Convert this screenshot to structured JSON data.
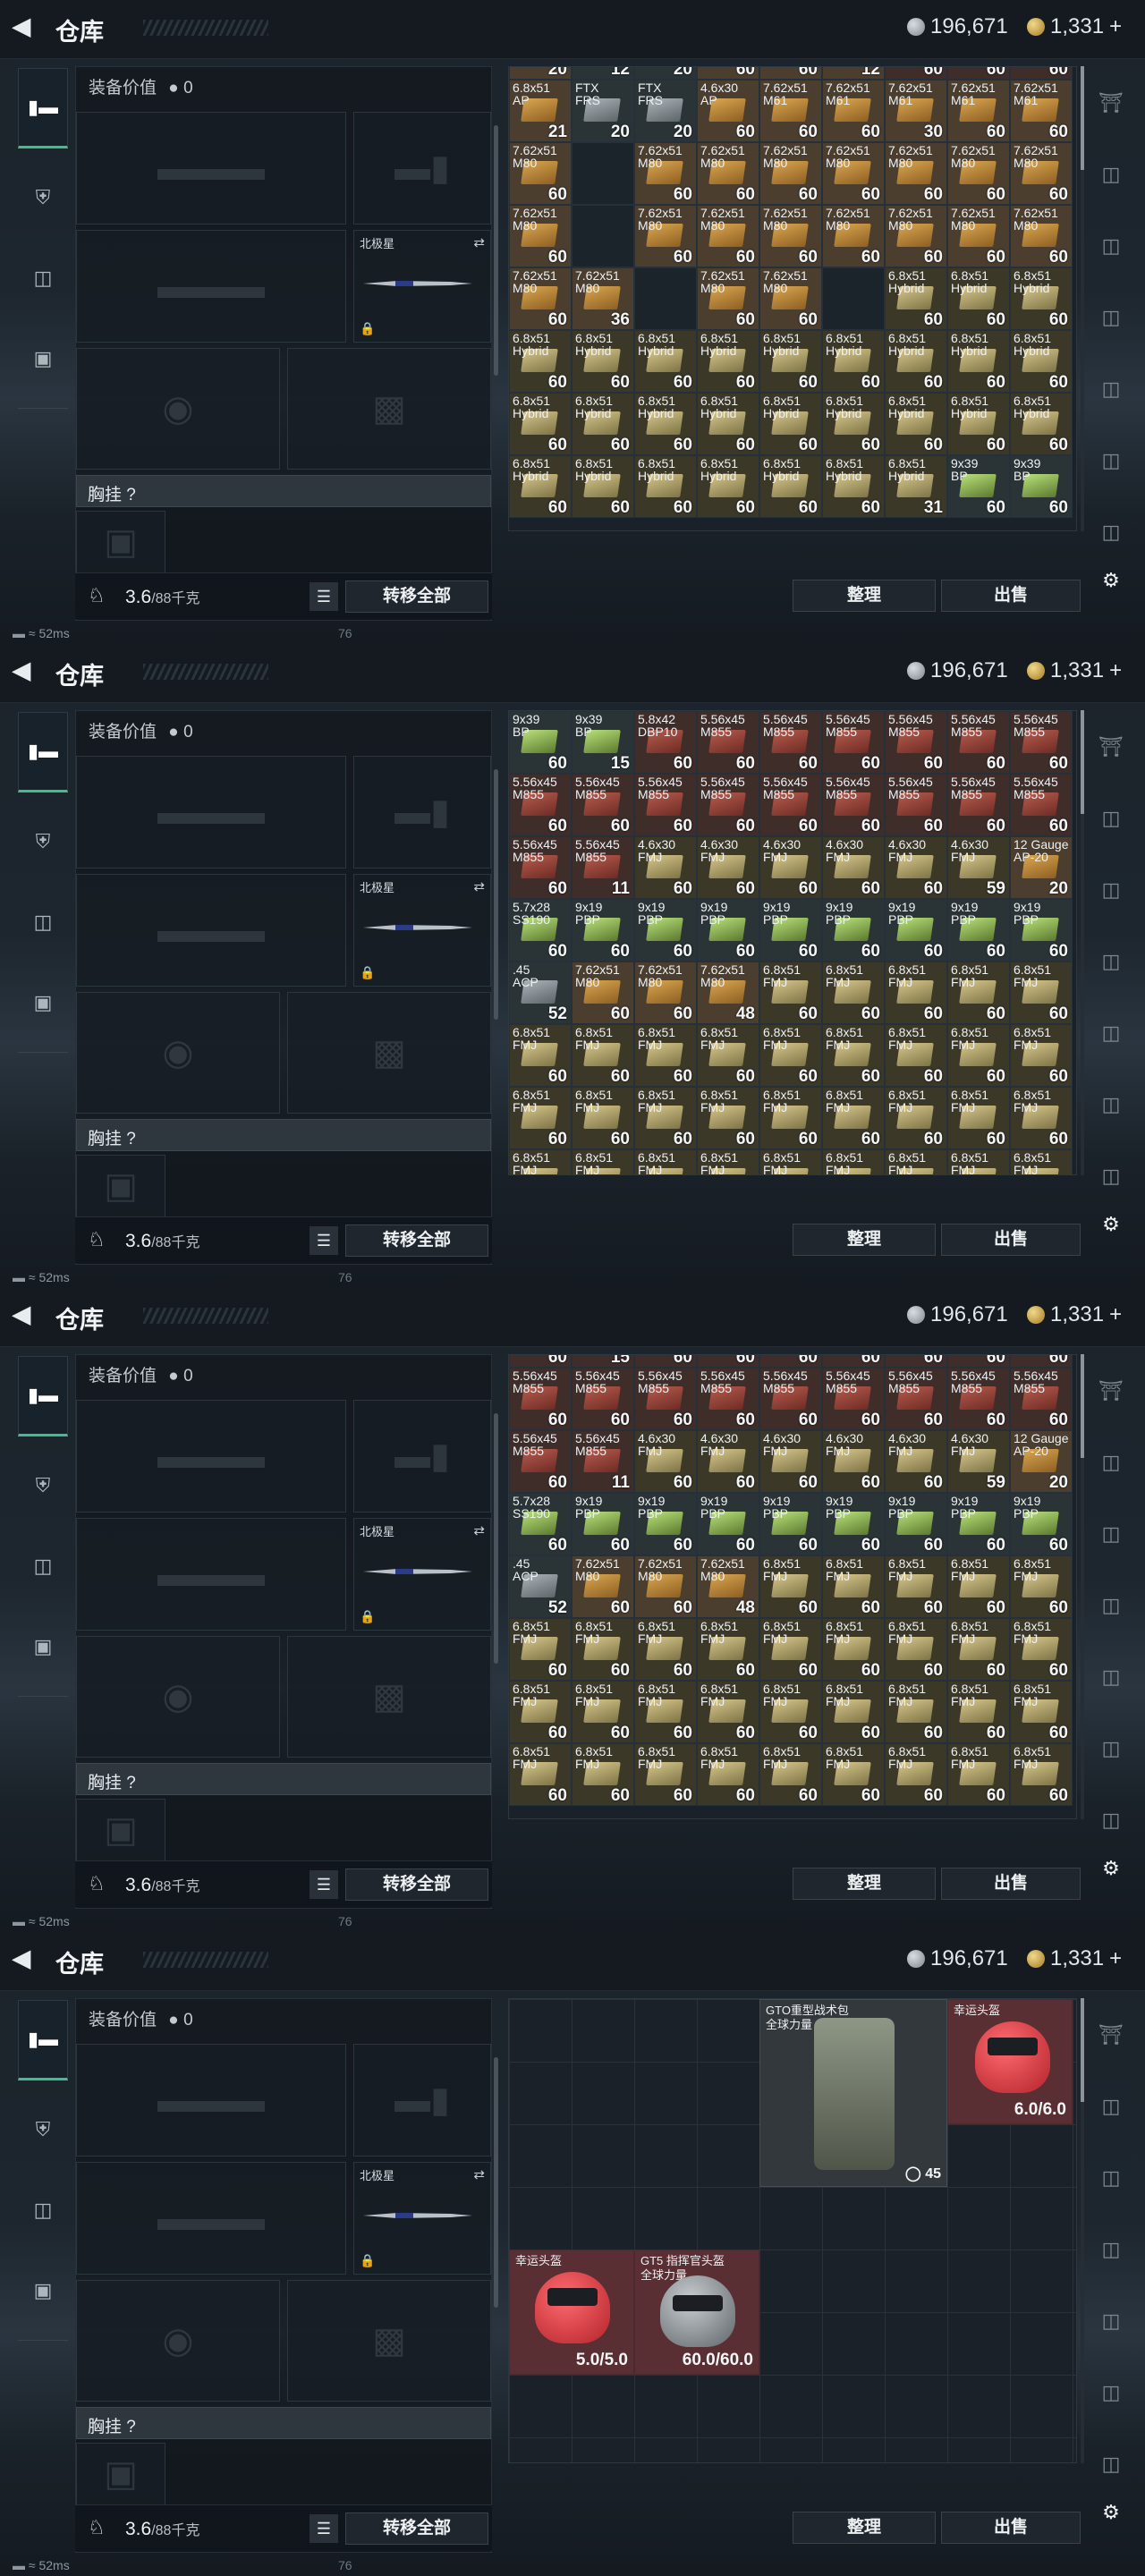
{
  "header": {
    "title": "仓库",
    "silver": "196,671",
    "gold": "1,331",
    "gold_plus": "+"
  },
  "equipment": {
    "value_label": "装备价值",
    "value": "0",
    "knife_name": "北极星",
    "vest_label": "胸挂",
    "vest_help": "?",
    "weight": "3.6",
    "weight_max": "/88千克",
    "transfer_all": "转移全部"
  },
  "actions": {
    "sort": "整理",
    "sell": "出售"
  },
  "status": {
    "ping": "52ms",
    "code": "76"
  },
  "colors": {
    "accent": "#3fbf8f",
    "brass": "#d9a64f",
    "tan": "#d6c68a",
    "red": "#b75b4d",
    "green": "#b8e07a",
    "helmet_red": "#b3242c"
  },
  "panels": [
    {
      "cells": [
        [
          "",
          "20",
          "b"
        ],
        [
          "",
          "12",
          "k"
        ],
        [
          "",
          "20",
          "k"
        ],
        [
          "",
          "60",
          "b"
        ],
        [
          "",
          "60",
          "b"
        ],
        [
          "",
          "12",
          "b"
        ],
        [
          "",
          "60",
          "r"
        ],
        [
          "",
          "60",
          "r"
        ],
        [
          "",
          "60",
          "r"
        ],
        [
          "6.8x51\nAP",
          "21",
          "b"
        ],
        [
          "FTX\nFRS",
          "20",
          "k"
        ],
        [
          "FTX\nFRS",
          "20",
          "k"
        ],
        [
          "4.6x30\nAP",
          "60",
          "b"
        ],
        [
          "7.62x51\nM61",
          "60",
          "b"
        ],
        [
          "7.62x51\nM61",
          "60",
          "b"
        ],
        [
          "7.62x51\nM61",
          "30",
          "b"
        ],
        [
          "7.62x51\nM61",
          "60",
          "b"
        ],
        [
          "7.62x51\nM61",
          "60",
          "b"
        ],
        [
          "7.62x51\nM80",
          "60",
          "b"
        ],
        [
          "",
          "",
          ""
        ],
        [
          "7.62x51\nM80",
          "60",
          "b"
        ],
        [
          "7.62x51\nM80",
          "60",
          "b"
        ],
        [
          "7.62x51\nM80",
          "60",
          "b"
        ],
        [
          "7.62x51\nM80",
          "60",
          "b"
        ],
        [
          "7.62x51\nM80",
          "60",
          "b"
        ],
        [
          "7.62x51\nM80",
          "60",
          "b"
        ],
        [
          "7.62x51\nM80",
          "60",
          "b"
        ],
        [
          "7.62x51\nM80",
          "60",
          "b"
        ],
        [
          "",
          "",
          ""
        ],
        [
          "7.62x51\nM80",
          "60",
          "b"
        ],
        [
          "7.62x51\nM80",
          "60",
          "b"
        ],
        [
          "7.62x51\nM80",
          "60",
          "b"
        ],
        [
          "7.62x51\nM80",
          "60",
          "b"
        ],
        [
          "7.62x51\nM80",
          "60",
          "b"
        ],
        [
          "7.62x51\nM80",
          "60",
          "b"
        ],
        [
          "7.62x51\nM80",
          "60",
          "b"
        ],
        [
          "7.62x51\nM80",
          "60",
          "b"
        ],
        [
          "7.62x51\nM80",
          "36",
          "b"
        ],
        [
          "",
          "",
          ""
        ],
        [
          "7.62x51\nM80",
          "60",
          "b"
        ],
        [
          "7.62x51\nM80",
          "60",
          "b"
        ],
        [
          "",
          "",
          ""
        ],
        [
          "6.8x51\nHybrid",
          "60",
          "t"
        ],
        [
          "6.8x51\nHybrid",
          "60",
          "t"
        ],
        [
          "6.8x51\nHybrid",
          "60",
          "t"
        ],
        [
          "6.8x51\nHybrid",
          "60",
          "t"
        ],
        [
          "6.8x51\nHybrid",
          "60",
          "t"
        ],
        [
          "6.8x51\nHybrid",
          "60",
          "t"
        ],
        [
          "6.8x51\nHybrid",
          "60",
          "t"
        ],
        [
          "6.8x51\nHybrid",
          "60",
          "t"
        ],
        [
          "6.8x51\nHybrid",
          "60",
          "t"
        ],
        [
          "6.8x51\nHybrid",
          "60",
          "t"
        ],
        [
          "6.8x51\nHybrid",
          "60",
          "t"
        ],
        [
          "6.8x51\nHybrid",
          "60",
          "t"
        ],
        [
          "6.8x51\nHybrid",
          "60",
          "t"
        ],
        [
          "6.8x51\nHybrid",
          "60",
          "t"
        ],
        [
          "6.8x51\nHybrid",
          "60",
          "t"
        ],
        [
          "6.8x51\nHybrid",
          "60",
          "t"
        ],
        [
          "6.8x51\nHybrid",
          "60",
          "t"
        ],
        [
          "6.8x51\nHybrid",
          "60",
          "t"
        ],
        [
          "6.8x51\nHybrid",
          "60",
          "t"
        ],
        [
          "6.8x51\nHybrid",
          "60",
          "t"
        ],
        [
          "6.8x51\nHybrid",
          "60",
          "t"
        ],
        [
          "6.8x51\nHybrid",
          "60",
          "t"
        ],
        [
          "6.8x51\nHybrid",
          "60",
          "t"
        ],
        [
          "6.8x51\nHybrid",
          "60",
          "t"
        ],
        [
          "6.8x51\nHybrid",
          "60",
          "t"
        ],
        [
          "6.8x51\nHybrid",
          "60",
          "t"
        ],
        [
          "6.8x51\nHybrid",
          "60",
          "t"
        ],
        [
          "6.8x51\nHybrid",
          "31",
          "t"
        ],
        [
          "9x39\nBP",
          "60",
          "k"
        ],
        [
          "9x39\nBP",
          "60",
          "k"
        ]
      ]
    },
    {
      "cells": [
        [
          "9x39\nBP",
          "60",
          "k"
        ],
        [
          "9x39\nBP",
          "15",
          "k"
        ],
        [
          "5.8x42\nDBP10",
          "60",
          "r"
        ],
        [
          "5.56x45\nM855",
          "60",
          "r"
        ],
        [
          "5.56x45\nM855",
          "60",
          "r"
        ],
        [
          "5.56x45\nM855",
          "60",
          "r"
        ],
        [
          "5.56x45\nM855",
          "60",
          "r"
        ],
        [
          "5.56x45\nM855",
          "60",
          "r"
        ],
        [
          "5.56x45\nM855",
          "60",
          "r"
        ],
        [
          "5.56x45\nM855",
          "60",
          "r"
        ],
        [
          "5.56x45\nM855",
          "60",
          "r"
        ],
        [
          "5.56x45\nM855",
          "60",
          "r"
        ],
        [
          "5.56x45\nM855",
          "60",
          "r"
        ],
        [
          "5.56x45\nM855",
          "60",
          "r"
        ],
        [
          "5.56x45\nM855",
          "60",
          "r"
        ],
        [
          "5.56x45\nM855",
          "60",
          "r"
        ],
        [
          "5.56x45\nM855",
          "60",
          "r"
        ],
        [
          "5.56x45\nM855",
          "60",
          "r"
        ],
        [
          "5.56x45\nM855",
          "60",
          "r"
        ],
        [
          "5.56x45\nM855",
          "11",
          "r"
        ],
        [
          "4.6x30\nFMJ",
          "60",
          "t"
        ],
        [
          "4.6x30\nFMJ",
          "60",
          "t"
        ],
        [
          "4.6x30\nFMJ",
          "60",
          "t"
        ],
        [
          "4.6x30\nFMJ",
          "60",
          "t"
        ],
        [
          "4.6x30\nFMJ",
          "60",
          "t"
        ],
        [
          "4.6x30\nFMJ",
          "59",
          "t"
        ],
        [
          "12 Gauge\nAP-20",
          "20",
          "b"
        ],
        [
          "5.7x28\nSS190",
          "60",
          "k"
        ],
        [
          "9x19\nPBP",
          "60",
          "k"
        ],
        [
          "9x19\nPBP",
          "60",
          "k"
        ],
        [
          "9x19\nPBP",
          "60",
          "k"
        ],
        [
          "9x19\nPBP",
          "60",
          "k"
        ],
        [
          "9x19\nPBP",
          "60",
          "k"
        ],
        [
          "9x19\nPBP",
          "60",
          "k"
        ],
        [
          "9x19\nPBP",
          "60",
          "k"
        ],
        [
          "9x19\nPBP",
          "60",
          "k"
        ],
        [
          ".45\nACP",
          "52",
          "k"
        ],
        [
          "7.62x51\nM80",
          "60",
          "b"
        ],
        [
          "7.62x51\nM80",
          "60",
          "b"
        ],
        [
          "7.62x51\nM80",
          "48",
          "b"
        ],
        [
          "6.8x51\nFMJ",
          "60",
          "t"
        ],
        [
          "6.8x51\nFMJ",
          "60",
          "t"
        ],
        [
          "6.8x51\nFMJ",
          "60",
          "t"
        ],
        [
          "6.8x51\nFMJ",
          "60",
          "t"
        ],
        [
          "6.8x51\nFMJ",
          "60",
          "t"
        ],
        [
          "6.8x51\nFMJ",
          "60",
          "t"
        ],
        [
          "6.8x51\nFMJ",
          "60",
          "t"
        ],
        [
          "6.8x51\nFMJ",
          "60",
          "t"
        ],
        [
          "6.8x51\nFMJ",
          "60",
          "t"
        ],
        [
          "6.8x51\nFMJ",
          "60",
          "t"
        ],
        [
          "6.8x51\nFMJ",
          "60",
          "t"
        ],
        [
          "6.8x51\nFMJ",
          "60",
          "t"
        ],
        [
          "6.8x51\nFMJ",
          "60",
          "t"
        ],
        [
          "6.8x51\nFMJ",
          "60",
          "t"
        ],
        [
          "6.8x51\nFMJ",
          "60",
          "t"
        ],
        [
          "6.8x51\nFMJ",
          "60",
          "t"
        ],
        [
          "6.8x51\nFMJ",
          "60",
          "t"
        ],
        [
          "6.8x51\nFMJ",
          "60",
          "t"
        ],
        [
          "6.8x51\nFMJ",
          "60",
          "t"
        ],
        [
          "6.8x51\nFMJ",
          "60",
          "t"
        ],
        [
          "6.8x51\nFMJ",
          "60",
          "t"
        ],
        [
          "6.8x51\nFMJ",
          "60",
          "t"
        ],
        [
          "6.8x51\nFMJ",
          "60",
          "t"
        ],
        [
          "6.8x51\nFMJ",
          "60",
          "t"
        ],
        [
          "6.8x51\nFMJ",
          "60",
          "t"
        ],
        [
          "6.8x51\nFMJ",
          "60",
          "t"
        ],
        [
          "6.8x51\nFMJ",
          "60",
          "t"
        ],
        [
          "6.8x51\nFMJ",
          "60",
          "t"
        ],
        [
          "6.8x51\nFMJ",
          "60",
          "t"
        ],
        [
          "6.8x51\nFMJ",
          "60",
          "t"
        ],
        [
          "6.8x51\nFMJ",
          "60",
          "t"
        ],
        [
          "6.8x51\nFMJ",
          "60",
          "t"
        ]
      ]
    },
    {
      "cells": [
        [
          "",
          "60",
          "r"
        ],
        [
          "",
          "15",
          "r"
        ],
        [
          "",
          "60",
          "r"
        ],
        [
          "",
          "60",
          "r"
        ],
        [
          "",
          "60",
          "r"
        ],
        [
          "",
          "60",
          "r"
        ],
        [
          "",
          "60",
          "r"
        ],
        [
          "",
          "60",
          "r"
        ],
        [
          "",
          "60",
          "r"
        ],
        [
          "5.56x45\nM855",
          "60",
          "r"
        ],
        [
          "5.56x45\nM855",
          "60",
          "r"
        ],
        [
          "5.56x45\nM855",
          "60",
          "r"
        ],
        [
          "5.56x45\nM855",
          "60",
          "r"
        ],
        [
          "5.56x45\nM855",
          "60",
          "r"
        ],
        [
          "5.56x45\nM855",
          "60",
          "r"
        ],
        [
          "5.56x45\nM855",
          "60",
          "r"
        ],
        [
          "5.56x45\nM855",
          "60",
          "r"
        ],
        [
          "5.56x45\nM855",
          "60",
          "r"
        ],
        [
          "5.56x45\nM855",
          "60",
          "r"
        ],
        [
          "5.56x45\nM855",
          "11",
          "r"
        ],
        [
          "4.6x30\nFMJ",
          "60",
          "t"
        ],
        [
          "4.6x30\nFMJ",
          "60",
          "t"
        ],
        [
          "4.6x30\nFMJ",
          "60",
          "t"
        ],
        [
          "4.6x30\nFMJ",
          "60",
          "t"
        ],
        [
          "4.6x30\nFMJ",
          "60",
          "t"
        ],
        [
          "4.6x30\nFMJ",
          "59",
          "t"
        ],
        [
          "12 Gauge\nAP-20",
          "20",
          "b"
        ],
        [
          "5.7x28\nSS190",
          "60",
          "k"
        ],
        [
          "9x19\nPBP",
          "60",
          "k"
        ],
        [
          "9x19\nPBP",
          "60",
          "k"
        ],
        [
          "9x19\nPBP",
          "60",
          "k"
        ],
        [
          "9x19\nPBP",
          "60",
          "k"
        ],
        [
          "9x19\nPBP",
          "60",
          "k"
        ],
        [
          "9x19\nPBP",
          "60",
          "k"
        ],
        [
          "9x19\nPBP",
          "60",
          "k"
        ],
        [
          "9x19\nPBP",
          "60",
          "k"
        ],
        [
          ".45\nACP",
          "52",
          "k"
        ],
        [
          "7.62x51\nM80",
          "60",
          "b"
        ],
        [
          "7.62x51\nM80",
          "60",
          "b"
        ],
        [
          "7.62x51\nM80",
          "48",
          "b"
        ],
        [
          "6.8x51\nFMJ",
          "60",
          "t"
        ],
        [
          "6.8x51\nFMJ",
          "60",
          "t"
        ],
        [
          "6.8x51\nFMJ",
          "60",
          "t"
        ],
        [
          "6.8x51\nFMJ",
          "60",
          "t"
        ],
        [
          "6.8x51\nFMJ",
          "60",
          "t"
        ],
        [
          "6.8x51\nFMJ",
          "60",
          "t"
        ],
        [
          "6.8x51\nFMJ",
          "60",
          "t"
        ],
        [
          "6.8x51\nFMJ",
          "60",
          "t"
        ],
        [
          "6.8x51\nFMJ",
          "60",
          "t"
        ],
        [
          "6.8x51\nFMJ",
          "60",
          "t"
        ],
        [
          "6.8x51\nFMJ",
          "60",
          "t"
        ],
        [
          "6.8x51\nFMJ",
          "60",
          "t"
        ],
        [
          "6.8x51\nFMJ",
          "60",
          "t"
        ],
        [
          "6.8x51\nFMJ",
          "60",
          "t"
        ],
        [
          "6.8x51\nFMJ",
          "60",
          "t"
        ],
        [
          "6.8x51\nFMJ",
          "60",
          "t"
        ],
        [
          "6.8x51\nFMJ",
          "60",
          "t"
        ],
        [
          "6.8x51\nFMJ",
          "60",
          "t"
        ],
        [
          "6.8x51\nFMJ",
          "60",
          "t"
        ],
        [
          "6.8x51\nFMJ",
          "60",
          "t"
        ],
        [
          "6.8x51\nFMJ",
          "60",
          "t"
        ],
        [
          "6.8x51\nFMJ",
          "60",
          "t"
        ],
        [
          "6.8x51\nFMJ",
          "60",
          "t"
        ],
        [
          "6.8x51\nFMJ",
          "60",
          "t"
        ],
        [
          "6.8x51\nFMJ",
          "60",
          "t"
        ],
        [
          "6.8x51\nFMJ",
          "60",
          "t"
        ],
        [
          "6.8x51\nFMJ",
          "60",
          "t"
        ],
        [
          "6.8x51\nFMJ",
          "60",
          "t"
        ],
        [
          "6.8x51\nFMJ",
          "60",
          "t"
        ],
        [
          "6.8x51\nFMJ",
          "60",
          "t"
        ],
        [
          "6.8x51\nFMJ",
          "60",
          "t"
        ],
        [
          "6.8x51\nFMJ",
          "60",
          "t"
        ]
      ]
    }
  ],
  "gear": {
    "backpack_name": "GTO重型战术包\n全球力量",
    "backpack_count": "45",
    "helmet1_name": "幸运头盔",
    "helmet1_dur": "6.0/6.0",
    "helmet2_name": "幸运头盔",
    "helmet2_dur": "5.0/5.0",
    "helmet3_name": "GT5 指挥官头盔\n全球力量",
    "helmet3_dur": "60.0/60.0"
  }
}
